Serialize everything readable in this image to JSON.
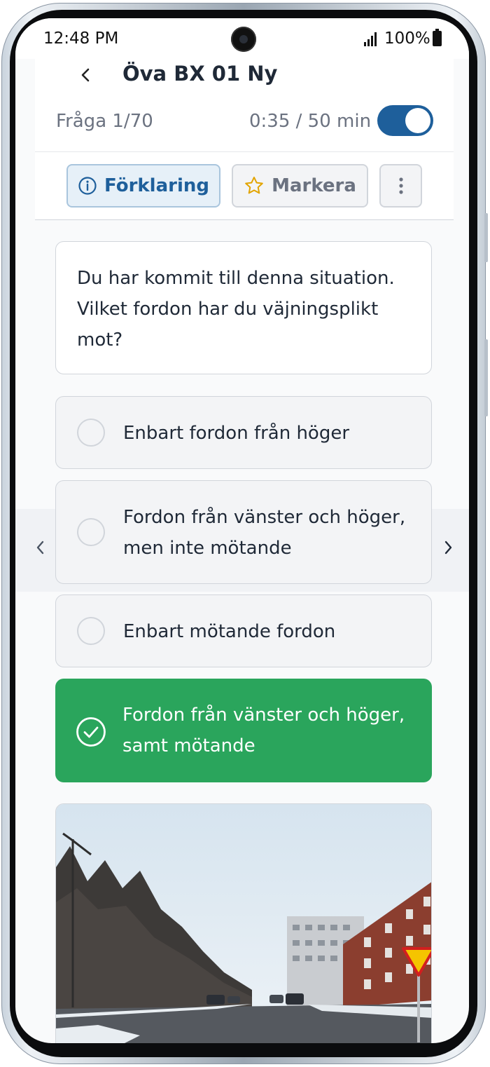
{
  "status_bar": {
    "time": "12:48 PM",
    "battery": "100%"
  },
  "header": {
    "title": "Öva BX 01 Ny",
    "question_counter": "Fråga 1/70",
    "timer": "0:35 / 50 min",
    "explain_label": "Förklaring",
    "mark_label": "Markera"
  },
  "question": {
    "text": "Du har kommit till denna situation. Vilket fordon har du väjningsplikt mot?"
  },
  "answers": [
    {
      "text": "Enbart fordon från höger",
      "selected": false
    },
    {
      "text": "Fordon från vänster och höger, men inte mötande",
      "selected": false
    },
    {
      "text": "Enbart mötande fordon",
      "selected": false
    },
    {
      "text": "Fordon från vänster och höger, samt mötande",
      "selected": true
    }
  ],
  "colors": {
    "accent": "#1e5f9b",
    "correct": "#2aa55c",
    "yield_sign": "#f5c400"
  },
  "icons": {
    "back": "chevron-left-icon",
    "explain": "info-icon",
    "mark": "star-icon",
    "more": "more-vertical-icon",
    "prev": "chevron-left-icon",
    "next": "chevron-right-icon",
    "correct": "check-circle-icon"
  }
}
